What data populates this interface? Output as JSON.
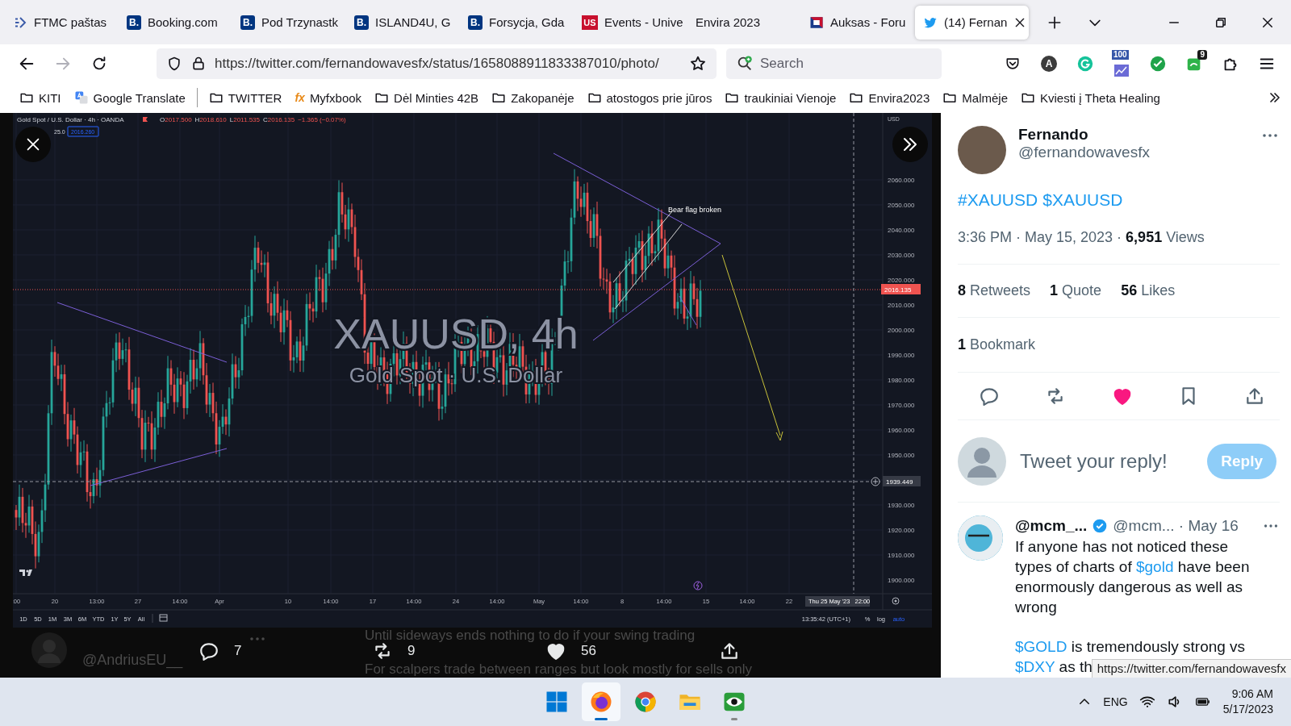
{
  "browser": {
    "tabs": [
      {
        "kind": "ftmc",
        "title": "FTMC paštas",
        "selected": false
      },
      {
        "kind": "booking",
        "icon_text": "B.",
        "title": "Booking.com",
        "selected": false
      },
      {
        "kind": "booking",
        "icon_text": "B.",
        "title": "Pod Trzynastk",
        "selected": false
      },
      {
        "kind": "booking",
        "icon_text": "B.",
        "title": "ISLAND4U, G",
        "selected": false
      },
      {
        "kind": "booking",
        "icon_text": "B.",
        "title": "Forsycja, Gda",
        "selected": false
      },
      {
        "kind": "us",
        "icon_text": "US",
        "title": "Events - Unive",
        "selected": false
      },
      {
        "kind": "plain",
        "title": "Envira 2023",
        "selected": false
      },
      {
        "kind": "flag",
        "title": "Auksas - Foru",
        "selected": false
      },
      {
        "kind": "bird",
        "title": "(14) Fernan",
        "selected": true
      }
    ],
    "nav": [
      {
        "kind": "back",
        "disabled": false
      },
      {
        "kind": "forward",
        "disabled": true
      },
      {
        "kind": "reload",
        "disabled": false
      }
    ],
    "url": "https://twitter.com/fernandowavesfx/status/1658088911833387010/photo/",
    "search_placeholder": "Search",
    "extensions": [
      {
        "kind": "pocket"
      },
      {
        "kind": "letter",
        "text": "A"
      },
      {
        "kind": "grammarly"
      },
      {
        "kind": "counter",
        "text": "100"
      },
      {
        "kind": "check"
      },
      {
        "kind": "badge",
        "text": "9"
      },
      {
        "kind": "puzzle"
      }
    ],
    "bookmarks": [
      {
        "kind": "folder",
        "label": "KITI"
      },
      {
        "kind": "translate",
        "label": "Google Translate"
      },
      {
        "kind": "separator"
      },
      {
        "kind": "folder",
        "label": "TWITTER"
      },
      {
        "kind": "fx",
        "icon_text": "fx",
        "label": "Myfxbook"
      },
      {
        "kind": "folder",
        "label": "Dėl Minties 42B"
      },
      {
        "kind": "folder",
        "label": "Zakopanėje"
      },
      {
        "kind": "folder",
        "label": "atostogos prie jūros"
      },
      {
        "kind": "folder",
        "label": "traukiniai Vienoje"
      },
      {
        "kind": "folder",
        "label": "Envira2023"
      },
      {
        "kind": "folder",
        "label": "Malmėje"
      },
      {
        "kind": "folder",
        "label": "Kviesti į Theta Healing"
      }
    ]
  },
  "viewer": {
    "chart": {
      "symbol_line": "Gold Spot / U.S. Dollar · 4h · OANDA",
      "ohlc": [
        {
          "key": "O",
          "value": "2017.500"
        },
        {
          "key": "H",
          "value": "2018.610"
        },
        {
          "key": "L",
          "value": "2011.535"
        },
        {
          "key": "C",
          "value": "2016.135"
        }
      ],
      "change": "−1.365 (−0.07%)",
      "indicator_value": "25.0",
      "price_box": "2016.260",
      "watermark_symbol": "XAUUSD, 4h",
      "watermark_name": "Gold Spot · U.S. Dollar",
      "currency": "USD",
      "price_ticks": [
        "2060.000",
        "2050.000",
        "2040.000",
        "2030.000",
        "2020.000",
        "2010.000",
        "2000.000",
        "1990.000",
        "1980.000",
        "1970.000",
        "1960.000",
        "1950.000",
        "1930.000",
        "1920.000",
        "1910.000",
        "1900.000"
      ],
      "last_price": "2016.135",
      "crosshair_price": "1939.449",
      "time_ticks": [
        ":00",
        "20",
        "13:00",
        "27",
        "14:00",
        "Apr",
        "10",
        "14:00",
        "17",
        "14:00",
        "24",
        "14:00",
        "May",
        "14:00",
        "8",
        "14:00",
        "15",
        "14:00",
        "22"
      ],
      "crosshair_date": "Thu 25 May '23",
      "crosshair_clock": "22:00",
      "annotation": "Bear flag broken",
      "ranges": [
        "1D",
        "5D",
        "1M",
        "3M",
        "6M",
        "YTD",
        "1Y",
        "5Y",
        "All"
      ],
      "clock": "13:35:42 (UTC+1)",
      "scale_options": [
        {
          "label": "%",
          "selected": false
        },
        {
          "label": "log",
          "selected": false
        },
        {
          "label": "auto",
          "selected": true
        }
      ]
    },
    "actions": [
      {
        "kind": "reply",
        "count": "7"
      },
      {
        "kind": "retweet",
        "count": "9"
      },
      {
        "kind": "like",
        "count": "56"
      },
      {
        "kind": "share"
      }
    ],
    "background": {
      "author_handle": "@AndriusEU__",
      "lines": [
        "Until sideways ends nothing to do if your swing trading",
        "For scalpers trade between ranges but look mostly for sells only"
      ]
    }
  },
  "tweet": {
    "author": {
      "name": "Fernando",
      "handle": "@fernandowavesfx"
    },
    "hashtags": [
      "#XAUUSD",
      "$XAUUSD"
    ],
    "meta": "3:36 PM · May 15, 2023 · **6,951** Views",
    "stats": [
      "**8** Retweets",
      "**1** Quote",
      "**56** Likes"
    ],
    "bookmarks": "**1** Bookmark",
    "actions": [
      {
        "kind": "reply",
        "liked": false
      },
      {
        "kind": "retweet",
        "liked": false
      },
      {
        "kind": "like",
        "liked": true
      },
      {
        "kind": "bookmark",
        "liked": false
      },
      {
        "kind": "share",
        "liked": false
      }
    ],
    "reply_box": {
      "placeholder": "Tweet your reply!",
      "button": "Reply"
    },
    "replies": [
      {
        "name": "@mcm_...",
        "verified": true,
        "meta": "@mcm... · May 16",
        "paragraphs": [
          [
            {
              "kind": "text",
              "text": "If anyone has not noticed these types of charts of "
            },
            {
              "kind": "link",
              "text": "$gold"
            },
            {
              "kind": "text",
              "text": " have been enormously dangerous as well as wrong"
            }
          ],
          [
            {
              "kind": "link",
              "text": "$GOLD"
            },
            {
              "kind": "text",
              "text": " is tremendously strong vs "
            },
            {
              "kind": "link",
              "text": "$DXY"
            },
            {
              "kind": "text",
              "text": " as th"
            }
          ]
        ]
      }
    ]
  },
  "status_tooltip": "https://twitter.com/fernandowavesfx",
  "taskbar": {
    "apps": [
      {
        "kind": "start",
        "active": false,
        "running": false
      },
      {
        "kind": "firefox",
        "active": true,
        "running": true
      },
      {
        "kind": "chrome",
        "active": false,
        "running": false
      },
      {
        "kind": "files",
        "active": false,
        "running": false
      },
      {
        "kind": "eye",
        "active": false,
        "running": true
      }
    ],
    "language": "ENG",
    "time": "9:06 AM",
    "date": "5/17/2023"
  }
}
